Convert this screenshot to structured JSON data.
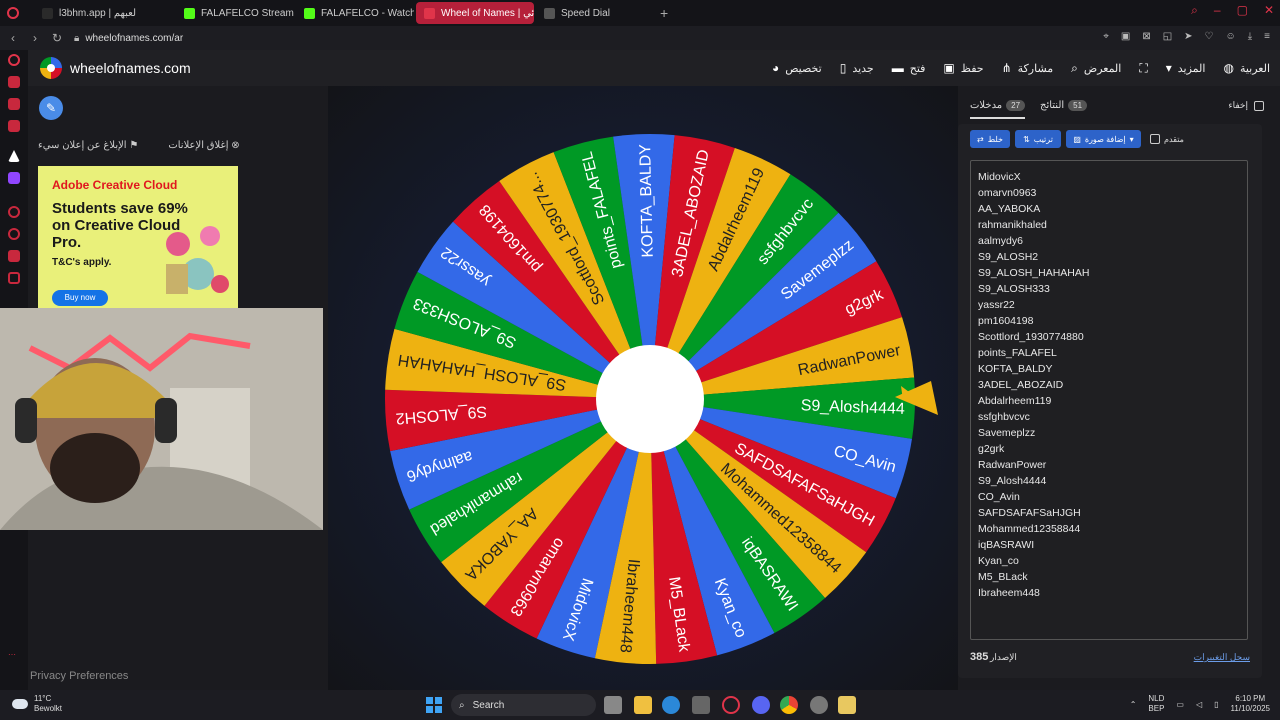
{
  "browser": {
    "tabs": [
      {
        "title": "l3bhm.app | لعبهم",
        "color": "#2a2a2a",
        "active": false
      },
      {
        "title": "FALAFELCO Stream - Wat",
        "color": "#53fc18",
        "active": false
      },
      {
        "title": "FALAFELCO - Watch clips",
        "color": "#53fc18",
        "active": false
      },
      {
        "title": "Wheel of Names | عشوائي",
        "color": "#e0344a",
        "active": true
      },
      {
        "title": "Speed Dial",
        "color": "#555555",
        "active": false
      }
    ],
    "url": "wheelofnames.com/ar",
    "new_tab": "+"
  },
  "site": {
    "name": "wheelofnames.com",
    "menu": [
      {
        "label": "العربية",
        "icon": "globe-icon",
        "glyph": "◍"
      },
      {
        "label": "المزيد",
        "icon": "dropdown-icon",
        "glyph": "▾"
      },
      {
        "label": "",
        "icon": "fullscreen-icon",
        "glyph": "⛶"
      },
      {
        "label": "المعرض",
        "icon": "search-icon",
        "glyph": "⌕"
      },
      {
        "label": "مشاركة",
        "icon": "share-icon",
        "glyph": "⋔"
      },
      {
        "label": "حفظ",
        "icon": "save-icon",
        "glyph": "▣"
      },
      {
        "label": "فتح",
        "icon": "folder-icon",
        "glyph": "▬"
      },
      {
        "label": "جديد",
        "icon": "new-file-icon",
        "glyph": "▯"
      },
      {
        "label": "تخصيص",
        "icon": "palette-icon",
        "glyph": "◕"
      }
    ]
  },
  "left": {
    "report_ad": "الإبلاغ عن إعلان سيء",
    "close_ads": "إغلاق الإعلانات",
    "ad": {
      "brand": "Adobe Creative Cloud",
      "headline": "Students save 69% on Creative Cloud Pro.",
      "terms": "T&C's apply.",
      "cta": "Buy now"
    },
    "privacy": "Privacy Preferences"
  },
  "wheel": {
    "entries": [
      "MidovicX",
      "omarvn0963",
      "AA_YABOKA",
      "rahmanikhaled",
      "aalmydy6",
      "S9_ALOSH2",
      "S9_ALOSH_HAHAHAH",
      "S9_ALOSH333",
      "yassr22",
      "pm1604198",
      "Scottlord_1930774...",
      "points_FALAFEL",
      "KOFTA_BALDY",
      "3ADEL_ABOZAID",
      "Abdalrheem119",
      "ssfghbvcvc",
      "Savemeplzz",
      "g2grk",
      "RadwanPower",
      "S9_Alosh4444",
      "CO_Avin",
      "SAFDSAFAFSaHJGH",
      "Mohammed12358844",
      "iqBASRAWI",
      "Kyan_co",
      "M5_BLack",
      "Ibraheem448"
    ],
    "colors": [
      "#3369e8",
      "#d50f25",
      "#eeb211",
      "#009925"
    ],
    "pointer_color": "#eeb211"
  },
  "panel": {
    "hide_label": "إخفاء",
    "tab_entries": {
      "label": "مدخلات",
      "count": "27"
    },
    "tab_results": {
      "label": "النتائج",
      "count": "51"
    },
    "shuffle": "خلط",
    "sort": "ترتيب",
    "add_image": "إضافة صورة",
    "advanced": "متقدم",
    "entries": [
      "MidovicX",
      "omarvn0963",
      "AA_YABOKA",
      "rahmanikhaled",
      "aalmydy6",
      "S9_ALOSH2",
      "S9_ALOSH_HAHAHAH",
      "S9_ALOSH333",
      "yassr22",
      "pm1604198",
      "Scottlord_1930774880",
      "points_FALAFEL",
      "KOFTA_BALDY",
      "3ADEL_ABOZAID",
      "Abdalrheem119",
      "ssfghbvcvc",
      "Savemeplzz",
      "g2grk",
      "RadwanPower",
      "S9_Alosh4444",
      "CO_Avin",
      "SAFDSAFAFSaHJGH",
      "Mohammed12358844",
      "iqBASRAWI",
      "Kyan_co",
      "M5_BLack",
      "Ibraheem448"
    ],
    "version_label": "الإصدار",
    "version": "385",
    "changelog": "سجل التغييرات"
  },
  "taskbar": {
    "temp": "11°C",
    "weather": "Bewolkt",
    "search": "Search",
    "lang": "NLD",
    "lang2": "BEP",
    "time": "6:10 PM",
    "date": "11/10/2025"
  }
}
